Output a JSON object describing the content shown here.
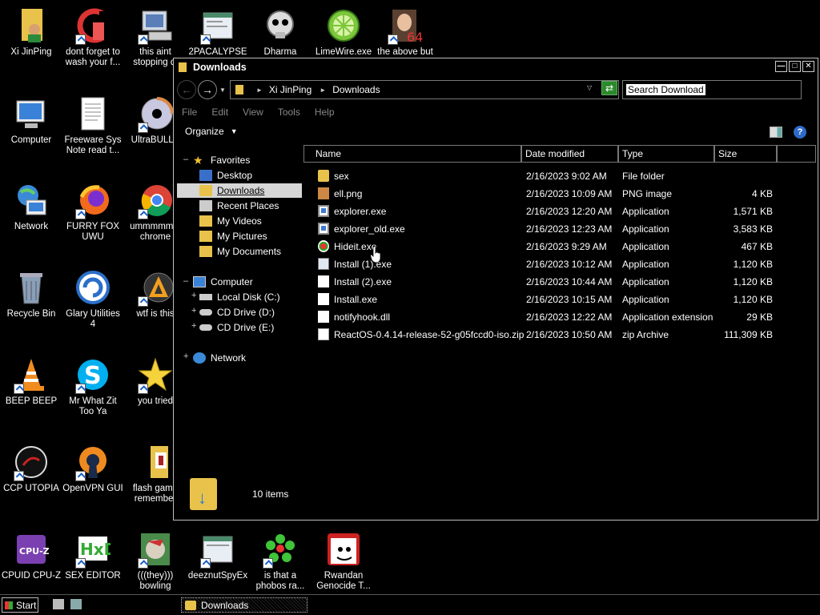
{
  "desktop": {
    "icons": [
      {
        "label": "Xi JinPing",
        "icon": "user-folder-icon"
      },
      {
        "label": "dont forget to wash your f...",
        "icon": "ccleaner-icon"
      },
      {
        "label": "this aint stopping di",
        "icon": "computer-tools-icon"
      },
      {
        "label": "2PACALYPSE",
        "icon": "window-app-icon"
      },
      {
        "label": "Dharma",
        "icon": "skull-icon"
      },
      {
        "label": "LimeWire.exe",
        "icon": "limewire-icon"
      },
      {
        "label": "the above but",
        "icon": "portrait-64-icon",
        "badge": "64"
      },
      {
        "label": "Computer",
        "icon": "computer-icon"
      },
      {
        "label": "Freeware Sys Note read t...",
        "icon": "text-document-icon"
      },
      {
        "label": "UltraBULLS",
        "icon": "disc-icon"
      },
      {
        "label": "Network",
        "icon": "network-icon"
      },
      {
        "label": "FURRY FOX UWU",
        "icon": "firefox-icon"
      },
      {
        "label": "ummmmmm chrome",
        "icon": "chrome-icon"
      },
      {
        "label": "Recycle Bin",
        "icon": "recycle-bin-icon"
      },
      {
        "label": "Glary Utilities 4",
        "icon": "glary-icon"
      },
      {
        "label": "wtf is this",
        "icon": "aimp-icon"
      },
      {
        "label": "BEEP BEEP",
        "icon": "vlc-cone-icon"
      },
      {
        "label": "Mr What Zit Too Ya",
        "icon": "skype-icon"
      },
      {
        "label": "you tried",
        "icon": "star-icon"
      },
      {
        "label": "CCP UTOPIA",
        "icon": "ccp-utopia-icon"
      },
      {
        "label": "OpenVPN GUI",
        "icon": "openvpn-icon"
      },
      {
        "label": "flash game remember",
        "icon": "flash-folder-icon"
      },
      {
        "label": "CPUID CPU-Z",
        "icon": "cpuz-icon"
      },
      {
        "label": "SEX EDITOR",
        "icon": "hxd-icon"
      },
      {
        "label": "(((they))) bowling",
        "icon": "bowling-icon"
      },
      {
        "label": "deeznutSpyEx",
        "icon": "spy-window-icon"
      },
      {
        "label": "is that a phobos ra...",
        "icon": "icq-flower-icon"
      },
      {
        "label": "Rwandan Genocide T...",
        "icon": "meme-face-icon"
      }
    ]
  },
  "window": {
    "title": "Downloads",
    "breadcrumb": [
      "Xi JinPing",
      "Downloads"
    ],
    "search_placeholder": "Search Downloads",
    "menu": [
      "File",
      "Edit",
      "View",
      "Tools",
      "Help"
    ],
    "organize_label": "Organize",
    "nav": {
      "favorites_label": "Favorites",
      "favorites": [
        "Desktop",
        "Downloads",
        "Recent Places",
        "My Videos",
        "My Pictures",
        "My Documents"
      ],
      "computer_label": "Computer",
      "drives": [
        "Local Disk (C:)",
        "CD Drive (D:)",
        "CD Drive (E:)"
      ],
      "network_label": "Network"
    },
    "columns": [
      "Name",
      "Date modified",
      "Type",
      "Size"
    ],
    "files": [
      {
        "name": "sex",
        "date": "2/16/2023 9:02 AM",
        "type": "File folder",
        "size": "",
        "icon": "folder-icon"
      },
      {
        "name": "ell.png",
        "date": "2/16/2023 10:09 AM",
        "type": "PNG image",
        "size": "4 KB",
        "icon": "png-image-icon"
      },
      {
        "name": "explorer.exe",
        "date": "2/16/2023 12:20 AM",
        "type": "Application",
        "size": "1,571 KB",
        "icon": "application-icon"
      },
      {
        "name": "explorer_old.exe",
        "date": "2/16/2023 12:23 AM",
        "type": "Application",
        "size": "3,583 KB",
        "icon": "application-icon"
      },
      {
        "name": "Hideit.exe",
        "date": "2/16/2023 9:29 AM",
        "type": "Application",
        "size": "467 KB",
        "icon": "hideit-icon"
      },
      {
        "name": "Install (1).exe",
        "date": "2/16/2023 10:12 AM",
        "type": "Application",
        "size": "1,120 KB",
        "icon": "installer-icon"
      },
      {
        "name": "Install (2).exe",
        "date": "2/16/2023 10:44 AM",
        "type": "Application",
        "size": "1,120 KB",
        "icon": "blank-file-icon"
      },
      {
        "name": "Install.exe",
        "date": "2/16/2023 10:15 AM",
        "type": "Application",
        "size": "1,120 KB",
        "icon": "blank-file-icon"
      },
      {
        "name": "notifyhook.dll",
        "date": "2/16/2023 12:22 AM",
        "type": "Application extension",
        "size": "29 KB",
        "icon": "dll-file-icon"
      },
      {
        "name": "ReactOS-0.4.14-release-52-g05fccd0-iso.zip",
        "date": "2/16/2023 10:50 AM",
        "type": "zip Archive",
        "size": "111,309 KB",
        "icon": "zip-file-icon"
      }
    ],
    "status": "10 items"
  },
  "taskbar": {
    "start_label": "Start",
    "task_label": "Downloads"
  }
}
